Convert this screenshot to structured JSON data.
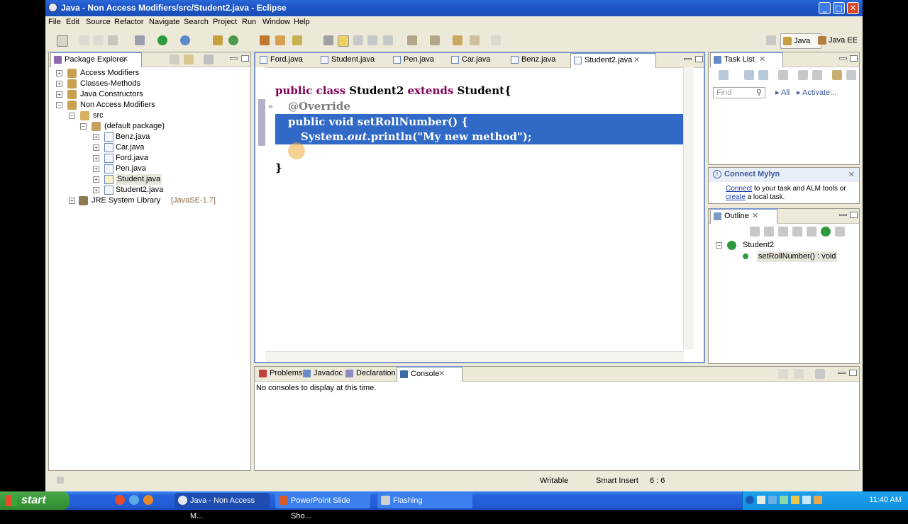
{
  "window": {
    "title": "Java - Non Access Modifiers/src/Student2.java - Eclipse"
  },
  "menu": [
    "File",
    "Edit",
    "Source",
    "Refactor",
    "Navigate",
    "Search",
    "Project",
    "Run",
    "Window",
    "Help"
  ],
  "perspectives": {
    "java": "Java",
    "javaee": "Java EE"
  },
  "package_explorer": {
    "title": "Package Explorer",
    "items": [
      {
        "label": "Access Modifiers"
      },
      {
        "label": "Classes-Methods"
      },
      {
        "label": "Java Constructors"
      },
      {
        "label": "Non Access Modifiers"
      },
      {
        "label": "src"
      },
      {
        "label": "(default package)"
      },
      {
        "label": "Benz.java"
      },
      {
        "label": "Car.java"
      },
      {
        "label": "Ford.java"
      },
      {
        "label": "Pen.java"
      },
      {
        "label": "Student.java"
      },
      {
        "label": "Student2.java"
      },
      {
        "label": "JRE System Library",
        "suffix": "[JavaSE-1.7]"
      }
    ]
  },
  "editor": {
    "tabs": [
      "Ford.java",
      "Student.java",
      "Pen.java",
      "Car.java",
      "Benz.java",
      "Student2.java"
    ],
    "active_tab": "Student2.java",
    "code": {
      "l1_kw": "public class ",
      "l1_name": "Student2 ",
      "l1_kw2": "extends ",
      "l1_rest": "Student{",
      "l2": "@Override",
      "l3_kw": "public void ",
      "l3_rest": "setRollNumber() {",
      "l4_a": "System.",
      "l4_b": "out",
      "l4_c": ".println(\"My new method\");",
      "l5": "}",
      "l6": "}"
    }
  },
  "task_list": {
    "title": "Task List",
    "find_placeholder": "Find",
    "all": "All",
    "activate": "Activate..."
  },
  "mylyn": {
    "title": "Connect Mylyn",
    "link1": "Connect",
    "text1": " to your task and ALM tools or",
    "link2": "create",
    "text2": " a local task."
  },
  "outline": {
    "title": "Outline",
    "class": "Student2",
    "method": "setRollNumber() : void"
  },
  "bottom_panel": {
    "tabs": [
      "Problems",
      "Javadoc",
      "Declaration",
      "Console"
    ],
    "active_tab": "Console",
    "message": "No consoles to display at this time."
  },
  "status_bar": {
    "writable": "Writable",
    "insert_mode": "Smart Insert",
    "position": "6 : 6"
  },
  "taskbar": {
    "start": "start",
    "buttons": [
      "Java - Non Access M...",
      "PowerPoint Slide Sho...",
      "Flashing"
    ],
    "clock": "11:40 AM"
  },
  "colors": {
    "keyword": "#7f0055",
    "selection": "#3169c6",
    "titlebar": "#1d56c8"
  }
}
